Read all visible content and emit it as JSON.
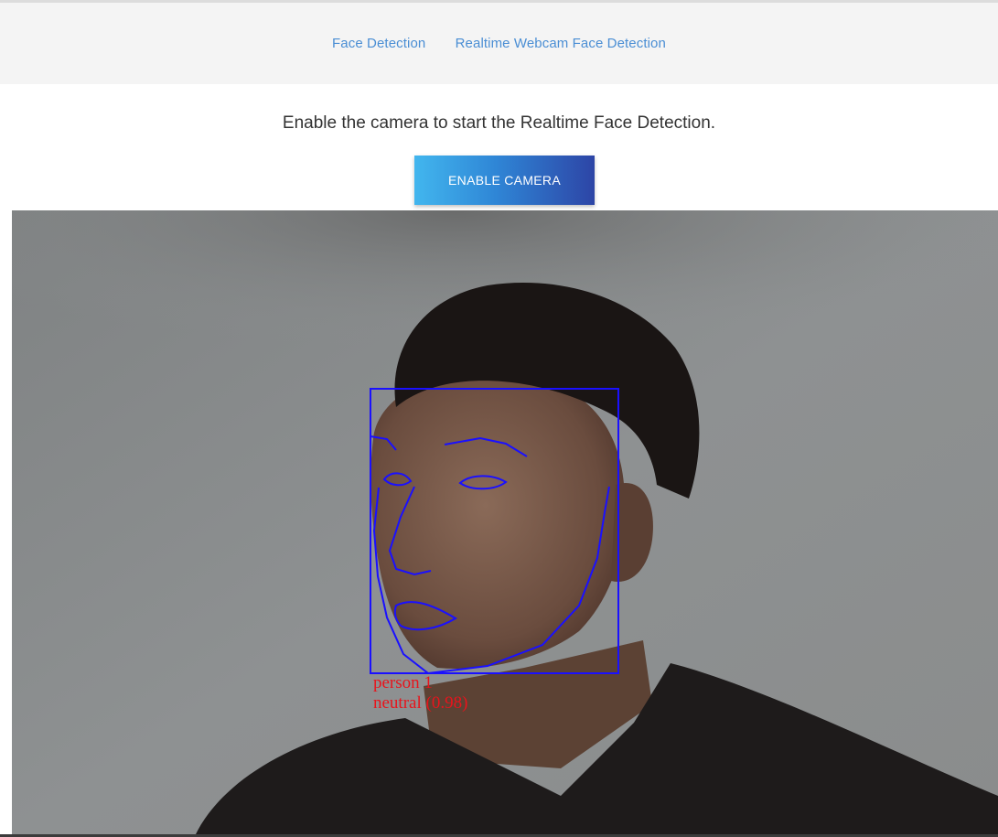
{
  "nav": {
    "links": [
      {
        "label": "Face Detection"
      },
      {
        "label": "Realtime Webcam Face Detection"
      }
    ],
    "link_color": "#4a8ed4"
  },
  "main": {
    "instruction": "Enable the camera to start the Realtime Face Detection.",
    "enable_button_label": "ENABLE CAMERA"
  },
  "detection": {
    "person_label": "person 1",
    "expression_label": "neutral (0.98)",
    "box_color": "#1a10ff",
    "label_color": "#e8141c"
  }
}
